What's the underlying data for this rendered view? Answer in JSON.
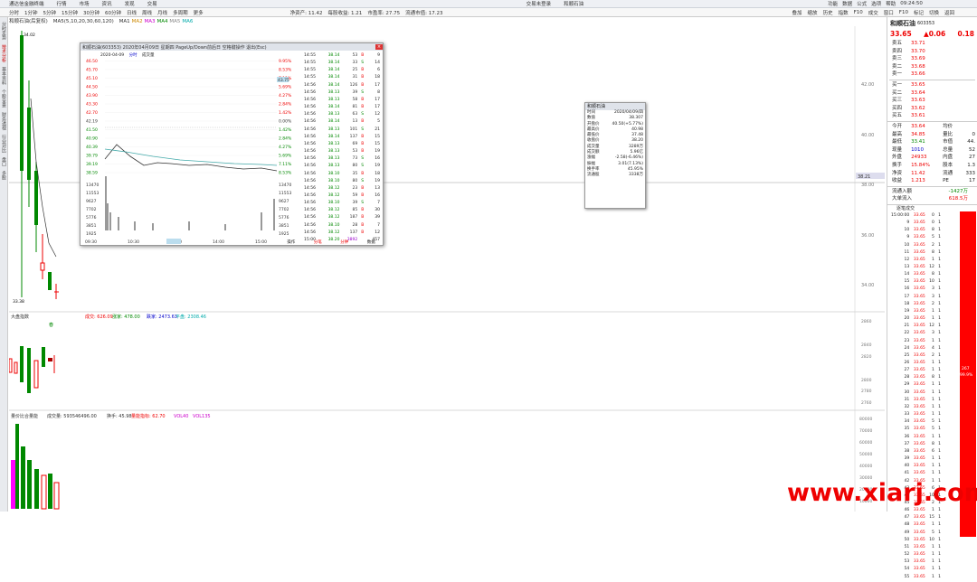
{
  "titlebar": {
    "app": "通达信金融终端",
    "menu": [
      "行情",
      "市场",
      "资讯",
      "发现",
      "交易"
    ],
    "center": [
      "交易未登录",
      "和顺石油"
    ],
    "right": [
      "功能",
      "数据",
      "公式",
      "选项",
      "帮助"
    ],
    "clock": "09:24:50"
  },
  "toolbar": {
    "periods": [
      "分时",
      "1分钟",
      "5分钟",
      "15分钟",
      "30分钟",
      "60分钟",
      "日线",
      "周线",
      "月线",
      "多周期",
      "更多"
    ],
    "ma_labels": [
      "MA1",
      "MA2",
      "MA3",
      "MA4",
      "MA5",
      "MA6"
    ],
    "stat_labels": [
      "净资产: 11.42",
      "每股收益: 1.21",
      "市盈率: 27.75",
      "流通市值: 17.23"
    ],
    "right_tools": [
      "叠加",
      "缩放",
      "历史",
      "指数",
      "F10",
      "成交",
      "窗口",
      "F10",
      "标记",
      "切换",
      "返回"
    ]
  },
  "leftbar": [
    "分时走势",
    "技术分析",
    "基本资料",
    "个股全景",
    "财务透视",
    "行业对比",
    "盘口",
    "多股"
  ],
  "main": {
    "stock_label": "和顺石油(后复权)",
    "ma_legend": "MA5(5,10,20,30,60,120)",
    "hi_price": "34.02",
    "lo_price": "33.38",
    "price_axis": [
      "42.00",
      "40.00",
      "38.00",
      "36.00",
      "34.00"
    ],
    "cur_price_tag": "38.21"
  },
  "vol_panel": {
    "title": "大盘指数",
    "indicators": [
      "成交: 626.09",
      "涨家: 478.00",
      "跌家: 2473.63",
      "平盘: 2308.46"
    ],
    "axis": [
      "2860",
      "2840",
      "2820",
      "2800",
      "2780",
      "2760"
    ]
  },
  "vol2_panel": {
    "title": "量价比合量能",
    "indicators": [
      "成交量: 593546496.00",
      "换手: 45.98",
      "量能指标: 62.70",
      "VOL40",
      "VOL135"
    ],
    "axis": [
      "80000",
      "70000",
      "60000",
      "50000",
      "40000",
      "30000",
      "20000",
      "10000"
    ]
  },
  "popup": {
    "title": "和顺石油(603353) 2020年04月09日 星期四 PageUp/Down前后日 空格键操作 退出(Esc)",
    "date": "2020-04-09",
    "tab_labels": [
      "分时",
      "成交量"
    ],
    "prices": [
      "46.50",
      "45.70",
      "45.10",
      "44.50",
      "43.90",
      "43.30",
      "42.70",
      "42.19",
      "41.50",
      "40.90",
      "40.39",
      "39.79",
      "39.19",
      "38.59"
    ],
    "pcts": [
      "9.95%",
      "8.53%",
      "7.11%",
      "5.69%",
      "4.27%",
      "2.84%",
      "1.42%",
      "0.00%",
      "1.42%",
      "2.84%",
      "4.27%",
      "5.69%",
      "7.11%",
      "8.53%"
    ],
    "price_tag": "43.75",
    "vol_axis": [
      "13470",
      "11553",
      "9627",
      "7702",
      "5776",
      "3851",
      "1925"
    ],
    "times": [
      "09:30",
      "10:30",
      "11:30",
      "14:00",
      "15:00"
    ],
    "trades": [
      [
        "14:55",
        "38.14",
        "53",
        "B",
        "9"
      ],
      [
        "14:55",
        "38.14",
        "33",
        "S",
        "14"
      ],
      [
        "14:55",
        "38.14",
        "25",
        "B",
        "6"
      ],
      [
        "14:55",
        "38.14",
        "31",
        "B",
        "18"
      ],
      [
        "14:56",
        "38.14",
        "126",
        "B",
        "17"
      ],
      [
        "14:56",
        "38.13",
        "39",
        "S",
        "8"
      ],
      [
        "14:56",
        "38.13",
        "58",
        "B",
        "17"
      ],
      [
        "14:56",
        "38.14",
        "81",
        "B",
        "17"
      ],
      [
        "14:56",
        "38.13",
        "63",
        "S",
        "12"
      ],
      [
        "14:56",
        "38.14",
        "13",
        "B",
        "5"
      ],
      [
        "14:56",
        "38.13",
        "101",
        "S",
        "21"
      ],
      [
        "14:56",
        "38.14",
        "137",
        "B",
        "15"
      ],
      [
        "14:56",
        "38.13",
        "69",
        "B",
        "15"
      ],
      [
        "14:56",
        "38.13",
        "53",
        "B",
        "19"
      ],
      [
        "14:56",
        "38.13",
        "73",
        "S",
        "16"
      ],
      [
        "14:56",
        "38.13",
        "80",
        "S",
        "19"
      ],
      [
        "14:56",
        "38.10",
        "35",
        "B",
        "18"
      ],
      [
        "14:56",
        "38.10",
        "80",
        "S",
        "19"
      ],
      [
        "14:56",
        "38.12",
        "23",
        "B",
        "13"
      ],
      [
        "14:56",
        "38.12",
        "59",
        "B",
        "16"
      ],
      [
        "14:56",
        "38.10",
        "39",
        "S",
        "7"
      ],
      [
        "14:56",
        "38.12",
        "85",
        "B",
        "30"
      ],
      [
        "14:56",
        "38.12",
        "187",
        "B",
        "39"
      ],
      [
        "14:56",
        "38.10",
        "28",
        "B",
        "7"
      ],
      [
        "14:56",
        "38.12",
        "137",
        "B",
        "12"
      ],
      [
        "15:00",
        "38.20",
        "3892",
        "",
        "457"
      ]
    ],
    "bottom_tabs": [
      "操作",
      "分笔",
      "分钟",
      "数据"
    ]
  },
  "info": {
    "title": "和顺石油",
    "rows": [
      [
        "时间",
        "2020/04/09/四"
      ],
      [
        "数值",
        "38.307"
      ],
      [
        "开盘价",
        "40.50(+5.77%)"
      ],
      [
        "最高价",
        "40.98"
      ],
      [
        "最低价",
        "37.48"
      ],
      [
        "收盘价",
        "38.20"
      ],
      [
        "成交量",
        "3289万"
      ],
      [
        "成交额",
        "5.96亿"
      ],
      [
        "涨幅",
        "-2.58(-6.46%)"
      ],
      [
        "振幅",
        "3.01(7.13%)"
      ],
      [
        "换手率",
        "45.95%"
      ],
      [
        "流通股",
        "3338万"
      ]
    ]
  },
  "right": {
    "name": "和顺石油",
    "code": "603353",
    "price": "33.65",
    "change": "▲0.06",
    "pct": "0.18",
    "asks": [
      [
        "卖五",
        "33.71"
      ],
      [
        "卖四",
        "33.70"
      ],
      [
        "卖三",
        "33.69"
      ],
      [
        "卖二",
        "33.68"
      ],
      [
        "卖一",
        "33.66"
      ]
    ],
    "bids": [
      [
        "买一",
        "33.65"
      ],
      [
        "买二",
        "33.64"
      ],
      [
        "买三",
        "33.63"
      ],
      [
        "买四",
        "33.62"
      ],
      [
        "买五",
        "33.61"
      ]
    ],
    "stats": [
      [
        "今开",
        "33.64",
        "均价",
        ""
      ],
      [
        "最高",
        "34.85",
        "量比",
        "0"
      ],
      [
        "最低",
        "33.41",
        "市值",
        "44."
      ],
      [
        "现量",
        "1010",
        "总量",
        "52"
      ],
      [
        "外盘",
        "24933",
        "内盘",
        "27"
      ],
      [
        "换手",
        "15.84%",
        "股本",
        "1.3"
      ],
      [
        "净资",
        "11.42",
        "流通",
        "333"
      ],
      [
        "收益",
        "1.213",
        "PE",
        "17"
      ]
    ],
    "flow": [
      [
        "流通入额",
        "-1427万"
      ],
      [
        "大单流入",
        "618.5万"
      ]
    ],
    "ticks_title": "逐笔成交",
    "ticks": [
      [
        "15:00:00",
        "33.65",
        "0",
        "1"
      ],
      [
        "9",
        "33.65",
        "0",
        "1"
      ],
      [
        "10",
        "33.65",
        "8",
        "1"
      ],
      [
        "9",
        "33.65",
        "5",
        "1"
      ],
      [
        "10",
        "33.65",
        "2",
        "1"
      ],
      [
        "11",
        "33.65",
        "8",
        "1"
      ],
      [
        "12",
        "33.65",
        "1",
        "1"
      ],
      [
        "13",
        "33.65",
        "12",
        "1"
      ],
      [
        "14",
        "33.65",
        "8",
        "1"
      ],
      [
        "15",
        "33.65",
        "10",
        "1"
      ],
      [
        "16",
        "33.65",
        "3",
        "1"
      ],
      [
        "17",
        "33.65",
        "3",
        "1"
      ],
      [
        "18",
        "33.65",
        "2",
        "1"
      ],
      [
        "19",
        "33.65",
        "1",
        "1"
      ],
      [
        "20",
        "33.65",
        "1",
        "1"
      ],
      [
        "21",
        "33.65",
        "12",
        "1"
      ],
      [
        "22",
        "33.65",
        "3",
        "1"
      ],
      [
        "23",
        "33.65",
        "1",
        "1"
      ],
      [
        "24",
        "33.65",
        "4",
        "1"
      ],
      [
        "25",
        "33.65",
        "2",
        "1"
      ],
      [
        "26",
        "33.65",
        "1",
        "1"
      ],
      [
        "27",
        "33.65",
        "1",
        "1"
      ],
      [
        "28",
        "33.65",
        "8",
        "1"
      ],
      [
        "29",
        "33.65",
        "1",
        "1"
      ],
      [
        "30",
        "33.65",
        "1",
        "1"
      ],
      [
        "31",
        "33.65",
        "1",
        "1"
      ],
      [
        "32",
        "33.65",
        "1",
        "1"
      ],
      [
        "33",
        "33.65",
        "1",
        "1"
      ],
      [
        "34",
        "33.65",
        "5",
        "1"
      ],
      [
        "35",
        "33.65",
        "5",
        "1"
      ],
      [
        "36",
        "33.65",
        "1",
        "1"
      ],
      [
        "37",
        "33.65",
        "8",
        "1"
      ],
      [
        "38",
        "33.65",
        "6",
        "1"
      ],
      [
        "39",
        "33.65",
        "1",
        "1"
      ],
      [
        "40",
        "33.65",
        "1",
        "1"
      ],
      [
        "41",
        "33.65",
        "1",
        "1"
      ],
      [
        "42",
        "33.65",
        "1",
        "1"
      ],
      [
        "43",
        "33.65",
        "6",
        "1"
      ],
      [
        "44",
        "33.65",
        "10",
        "1"
      ],
      [
        "45",
        "33.65",
        "2",
        "1"
      ],
      [
        "46",
        "33.65",
        "1",
        "1"
      ],
      [
        "47",
        "33.65",
        "15",
        "1"
      ],
      [
        "48",
        "33.65",
        "1",
        "1"
      ],
      [
        "49",
        "33.65",
        "5",
        "1"
      ],
      [
        "50",
        "33.65",
        "10",
        "1"
      ],
      [
        "51",
        "33.65",
        "1",
        "1"
      ],
      [
        "52",
        "33.65",
        "1",
        "1"
      ],
      [
        "53",
        "33.65",
        "1",
        "1"
      ],
      [
        "54",
        "33.65",
        "1",
        "1"
      ],
      [
        "55",
        "33.65",
        "1",
        "1"
      ]
    ],
    "bar_label": "267",
    "bar_sub": "99.9%"
  },
  "watermark": "www.xiarj.com",
  "colors": {
    "up": "#e00000",
    "down": "#008000",
    "bg": "#ffffff"
  }
}
